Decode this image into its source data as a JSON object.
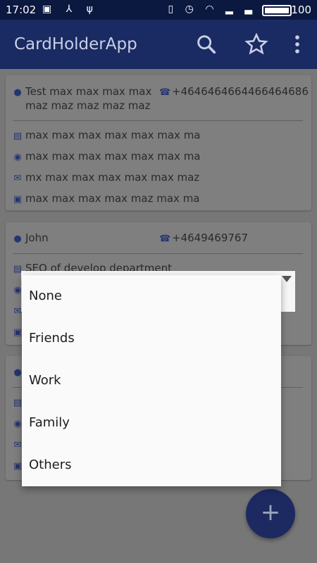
{
  "status": {
    "time": "17:02",
    "battery_level": "100"
  },
  "appbar": {
    "title": "CardHolderApp"
  },
  "cards": [
    {
      "name_line1": "Test max max max max",
      "name_line2": "maz maz maz maz maz",
      "phone": "+4646464664466464686",
      "details": [
        "max max max max max max ma",
        "max max max max max max ma",
        "mx max max max max max maz",
        "max max max max maz max ma"
      ]
    },
    {
      "name_line1": "John",
      "phone": "+4649469767",
      "details": [
        "SEO of develop department"
      ]
    }
  ],
  "dropdown": {
    "options": [
      "None",
      "Friends",
      "Work",
      "Family",
      "Others"
    ]
  },
  "fab": {
    "label": "+"
  }
}
